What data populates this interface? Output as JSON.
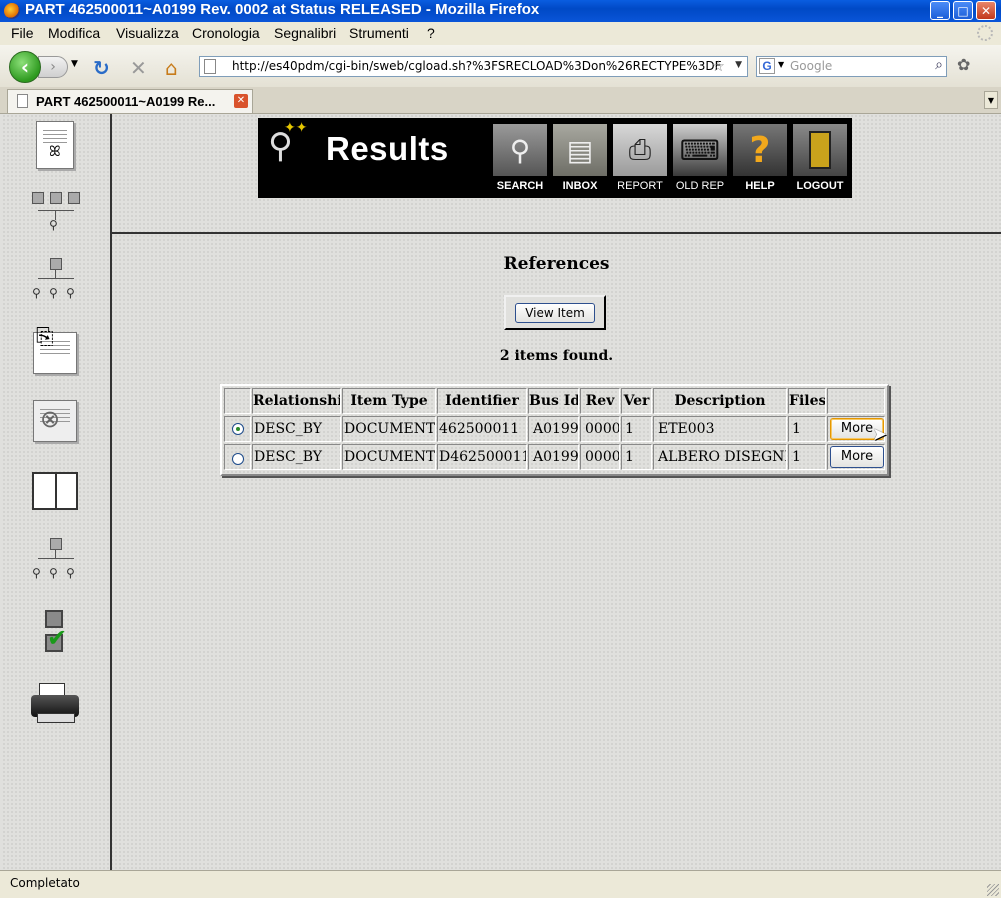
{
  "window": {
    "title": "PART 462500011~A0199 Rev. 0002 at Status RELEASED - Mozilla Firefox"
  },
  "menu": {
    "items": [
      "File",
      "Modifica",
      "Visualizza",
      "Cronologia",
      "Segnalibri",
      "Strumenti",
      "?"
    ]
  },
  "nav": {
    "url": "http://es40pdm/cgi-bin/sweb/cgload.sh?%3FSRECLOAD%3Don%26RECTYPE%3DF",
    "search_placeholder": "Google"
  },
  "tab": {
    "title": "PART 462500011~A0199 Re..."
  },
  "banner": {
    "title": "Results",
    "nav": [
      {
        "label": "SEARCH",
        "icon": "search-icon"
      },
      {
        "label": "INBOX",
        "icon": "inbox-tray-icon"
      },
      {
        "label": "REPORT",
        "icon": "printer-icon"
      },
      {
        "label": "OLD REP",
        "icon": "typewriter-icon"
      },
      {
        "label": "HELP",
        "icon": "question-mark-icon"
      },
      {
        "label": "LOGOUT",
        "icon": "door-icon"
      }
    ]
  },
  "sidebar": {
    "icons": [
      "document-part-icon",
      "bom-multi-level-icon",
      "bom-single-level-icon",
      "attachment-document-icon",
      "attachment-drawing-icon",
      "book-icon",
      "where-used-tree-icon",
      "checklist-icon",
      "printer-icon"
    ]
  },
  "references": {
    "title": "References",
    "view_item_label": "View Item",
    "found_text": "2 items found.",
    "columns": [
      "Relationship",
      "Item Type",
      "Identifier",
      "Bus Id",
      "Rev",
      "Ver",
      "Description",
      "Files"
    ],
    "rows": [
      {
        "selected": true,
        "cells": [
          "DESC_BY",
          "DOCUMENT",
          "462500011",
          "A0199",
          "0000",
          "1",
          "ETE003",
          "1"
        ],
        "more_label": "More"
      },
      {
        "selected": false,
        "cells": [
          "DESC_BY",
          "DOCUMENT",
          "D462500011",
          "A0199",
          "0000",
          "1",
          "ALBERO DISEGNI",
          "1"
        ],
        "more_label": "More"
      }
    ]
  },
  "status": {
    "text": "Completato"
  }
}
